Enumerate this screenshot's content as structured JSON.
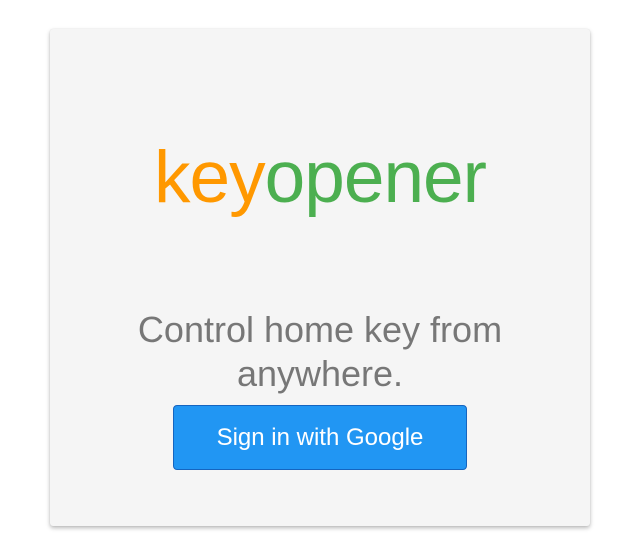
{
  "logo": {
    "part1": "key",
    "part2": "opener",
    "colors": {
      "part1": "#ff9800",
      "part2": "#4caf50"
    }
  },
  "tagline": "Control home key from anywhere.",
  "signin": {
    "label": "Sign in with Google",
    "color": "#2196f3"
  }
}
